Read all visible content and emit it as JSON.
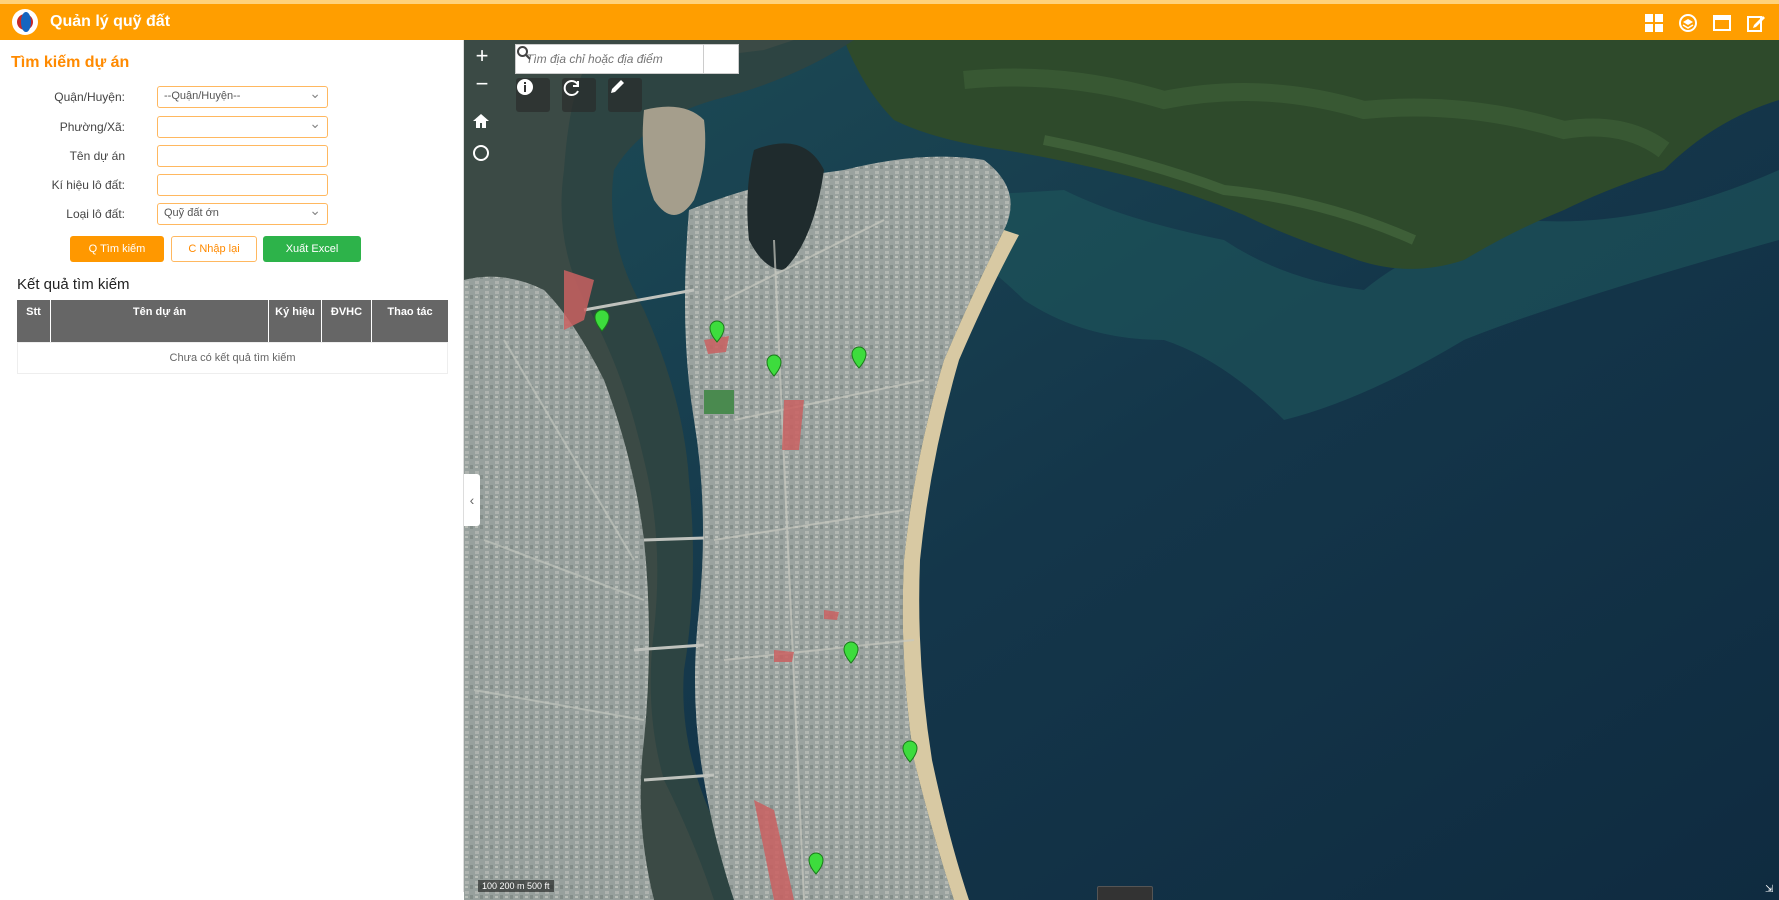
{
  "header": {
    "title": "Quản lý quỹ đất",
    "tools": [
      "grid-icon",
      "layers-icon",
      "window-icon",
      "edit-square-icon"
    ],
    "accent": "#ff9e00"
  },
  "left_panel": {
    "title": "Tìm kiếm dự án",
    "fields": [
      {
        "label": "Quận/Huyện:",
        "value": "--Quận/Huyện--",
        "type": "select"
      },
      {
        "label": "Phường/Xã:",
        "value": "",
        "type": "select"
      },
      {
        "label": "Tên dự án",
        "value": "",
        "type": "text"
      },
      {
        "label": "Kí hiệu lô đất:",
        "value": "",
        "type": "text"
      },
      {
        "label": "Loại lô đất:",
        "value": "Quỹ đất ớn",
        "type": "select"
      }
    ],
    "buttons": {
      "search": "Q Tìm kiếm",
      "reset": "C Nhập lại",
      "excel": "Xuất Excel"
    },
    "results_title": "Kết quả tìm kiếm",
    "table": {
      "columns": [
        "Stt",
        "Tên dự án",
        "Ký hiệu",
        "ĐVHC",
        "Thao tác"
      ],
      "empty_text": "Chưa có kết quả tìm kiếm"
    }
  },
  "map": {
    "search_placeholder": "Tìm địa chỉ hoặc địa điểm",
    "zoom_in": "+",
    "zoom_out": "−",
    "scale_text": "100 200 m 500 ft",
    "markers_count": 8,
    "tool_icons": [
      "info-icon",
      "refresh-icon",
      "pencil-icon"
    ],
    "marker_color": "#3ddc3d"
  }
}
